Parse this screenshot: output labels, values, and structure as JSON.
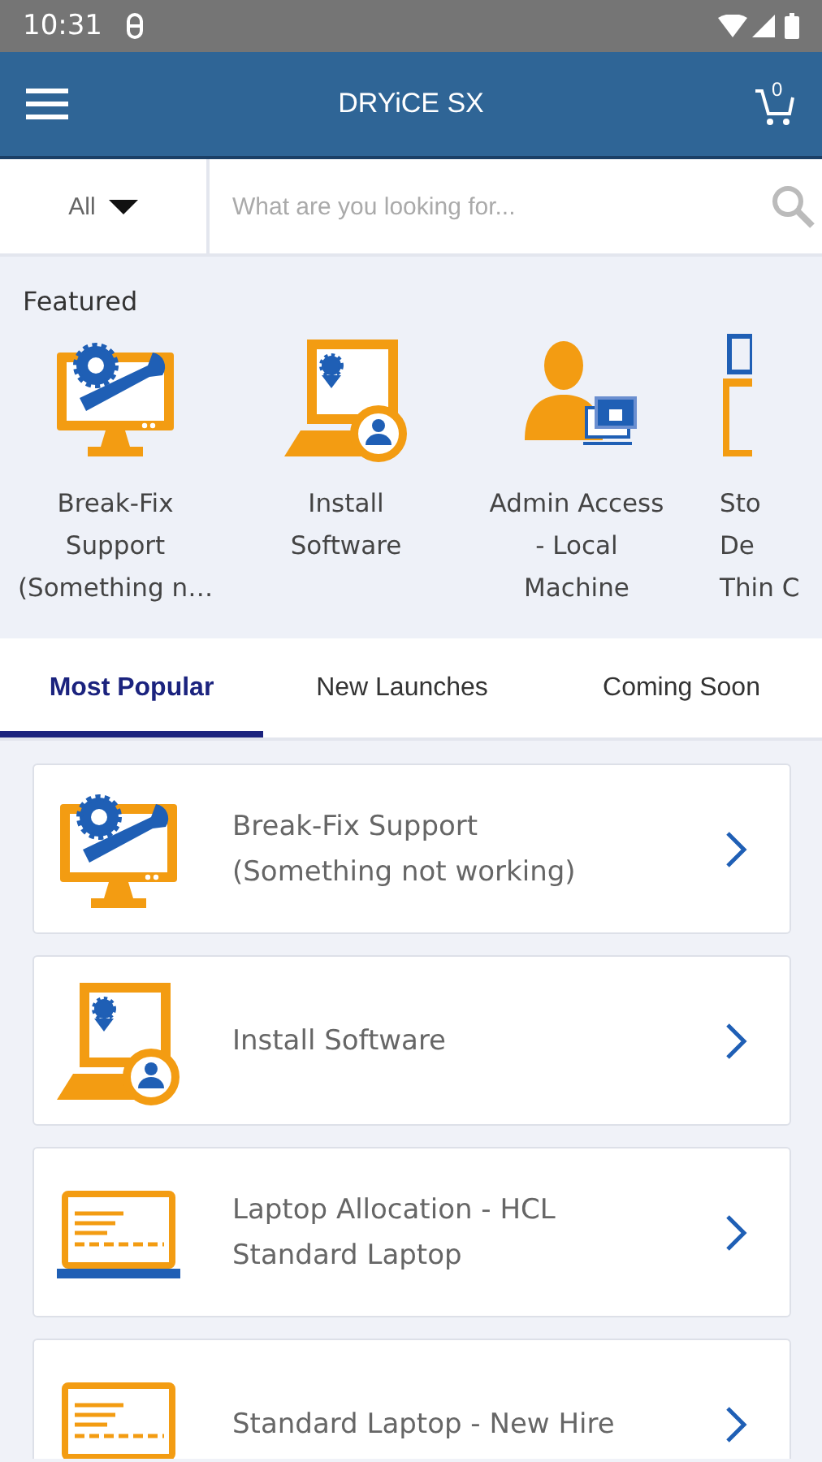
{
  "status_bar": {
    "time": "10:31"
  },
  "app_bar": {
    "title": "DRYiCE SX",
    "cart_count": "0"
  },
  "search": {
    "scope": "All",
    "placeholder": "What are you looking for..."
  },
  "featured": {
    "heading": "Featured",
    "items": [
      {
        "label": "Break-Fix\nSupport\n(Something n…",
        "kind": "repair",
        "partial": false
      },
      {
        "label": "Install\nSoftware",
        "kind": "install",
        "partial": false
      },
      {
        "label": "Admin Access\n- Local\nMachine",
        "kind": "admin",
        "partial": false
      },
      {
        "label": "Sto\nDe\nThin C",
        "kind": "desk",
        "partial": true
      }
    ]
  },
  "tabs": [
    {
      "label": "Most Popular",
      "selected": true
    },
    {
      "label": "New Launches",
      "selected": false
    },
    {
      "label": "Coming Soon",
      "selected": false
    }
  ],
  "catalog": [
    {
      "title": "Break-Fix Support\n(Something not working)",
      "kind": "repair"
    },
    {
      "title": "Install Software",
      "kind": "install"
    },
    {
      "title": "Laptop Allocation - HCL\nStandard Laptop",
      "kind": "laptop"
    },
    {
      "title": "Standard Laptop - New Hire",
      "kind": "laptop"
    }
  ]
}
